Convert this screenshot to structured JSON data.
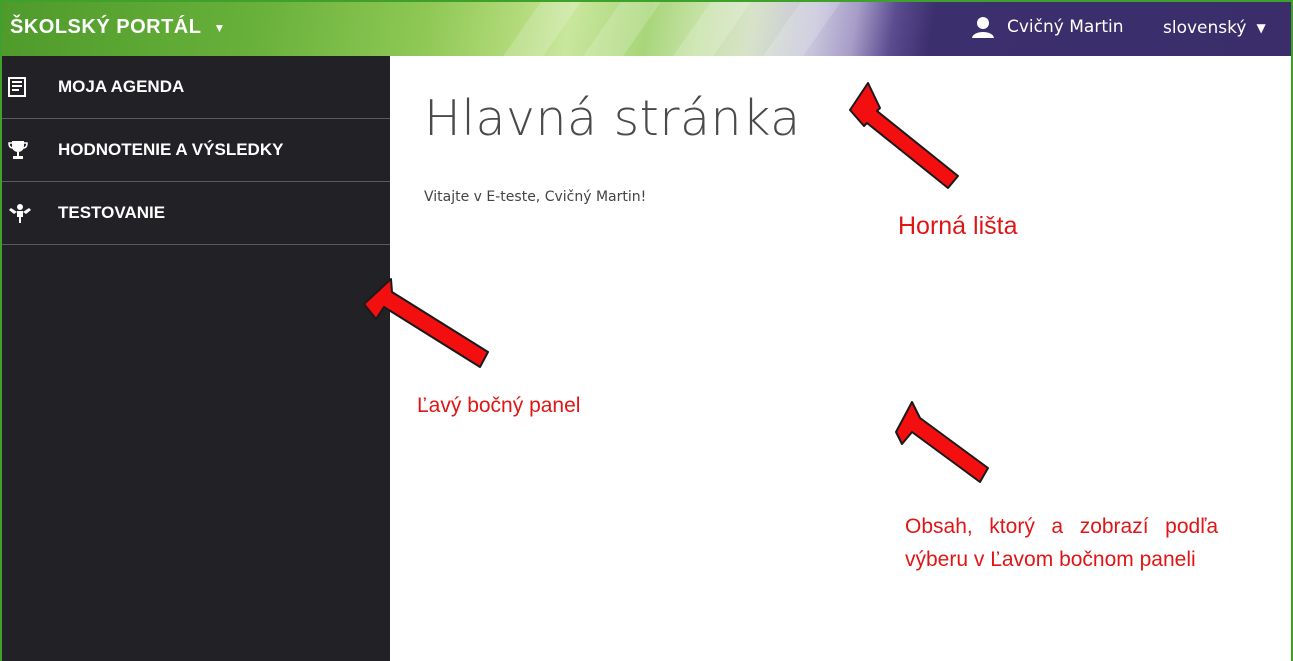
{
  "topbar": {
    "brand": "ŠKOLSKÝ PORTÁL",
    "user_name": "Cvičný Martin",
    "language": "slovenský",
    "colors": {
      "green": "#4e9a2b",
      "purple": "#3a2d6a"
    }
  },
  "sidebar": {
    "items": [
      {
        "label": "MOJA AGENDA",
        "icon": "agenda-icon"
      },
      {
        "label": "HODNOTENIE A VÝSLEDKY",
        "icon": "trophy-icon"
      },
      {
        "label": "TESTOVANIE",
        "icon": "testing-person-icon"
      }
    ],
    "background": "#222126"
  },
  "main": {
    "title": "Hlavná stránka",
    "welcome": "Vitajte v E-teste, Cvičný Martin!"
  },
  "annotations": {
    "top_bar": "Horná lišta",
    "left_panel": "Ľavý bočný panel",
    "content": "Obsah, ktorý a zobrazí podľa výberu v Ľavom bočnom paneli",
    "color": "#e01616"
  }
}
